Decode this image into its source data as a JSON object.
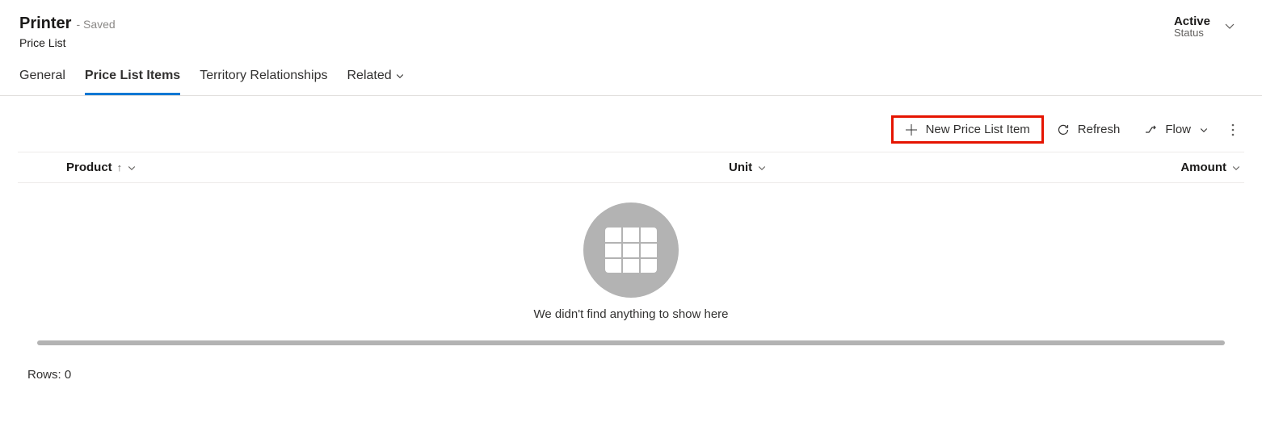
{
  "header": {
    "title": "Printer",
    "save_state": "- Saved",
    "subtitle": "Price List",
    "status": {
      "value": "Active",
      "label": "Status"
    }
  },
  "tabs": {
    "general": "General",
    "price_list_items": "Price List Items",
    "territory": "Territory Relationships",
    "related": "Related"
  },
  "toolbar": {
    "new_item": "New Price List Item",
    "refresh": "Refresh",
    "flow": "Flow"
  },
  "grid": {
    "columns": {
      "product": "Product",
      "unit": "Unit",
      "amount": "Amount"
    },
    "empty_message": "We didn't find anything to show here"
  },
  "footer": {
    "rows_label": "Rows: 0"
  }
}
